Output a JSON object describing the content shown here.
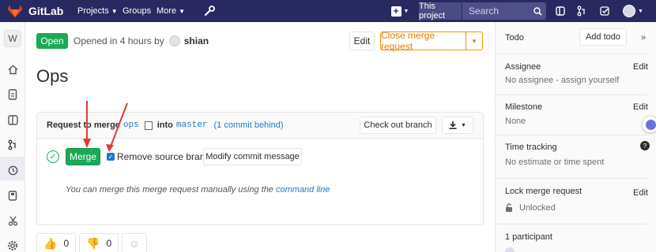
{
  "topbar": {
    "brand": "GitLab",
    "nav": [
      "Projects",
      "Groups",
      "More"
    ],
    "search_scope": "This project",
    "search_placeholder": "Search"
  },
  "sidebar": {
    "project_initial": "W",
    "icons": [
      "home-icon",
      "file-icon",
      "board-icon",
      "merge-request-icon",
      "cicd-icon",
      "wiki-icon",
      "snippets-icon",
      "settings-icon"
    ]
  },
  "mr": {
    "status": "Open",
    "opened_text": "Opened in 4 hours by",
    "author": "shian",
    "edit_label": "Edit",
    "close_label": "Close merge request",
    "title": "Ops"
  },
  "widget": {
    "request_to_merge": "Request to merge",
    "source_branch": "ops",
    "into": "into",
    "target_branch": "master",
    "behind": "(1 commit behind)",
    "checkout_label": "Check out branch",
    "merge_label": "Merge",
    "remove_source_label": "Remove source branch",
    "modify_commit_label": "Modify commit message",
    "hint_prefix": "You can merge this merge request manually using the",
    "hint_link": "command line"
  },
  "awards": {
    "thumbs_up_count": "0",
    "thumbs_down_count": "0"
  },
  "right_sidebar": {
    "todo_label": "Todo",
    "add_todo_label": "Add todo",
    "assignee_title": "Assignee",
    "assignee_value": "No assignee - assign yourself",
    "milestone_title": "Milestone",
    "milestone_value": "None",
    "time_title": "Time tracking",
    "time_value": "No estimate or time spent",
    "lock_title": "Lock merge request",
    "lock_value": "Unlocked",
    "participants": "1 participant",
    "edit_label": "Edit"
  },
  "colors": {
    "navbar": "#292961",
    "success": "#1aaa55",
    "link": "#1f78d1",
    "warning": "#fc9403",
    "annotation_arrow": "#e53935"
  }
}
